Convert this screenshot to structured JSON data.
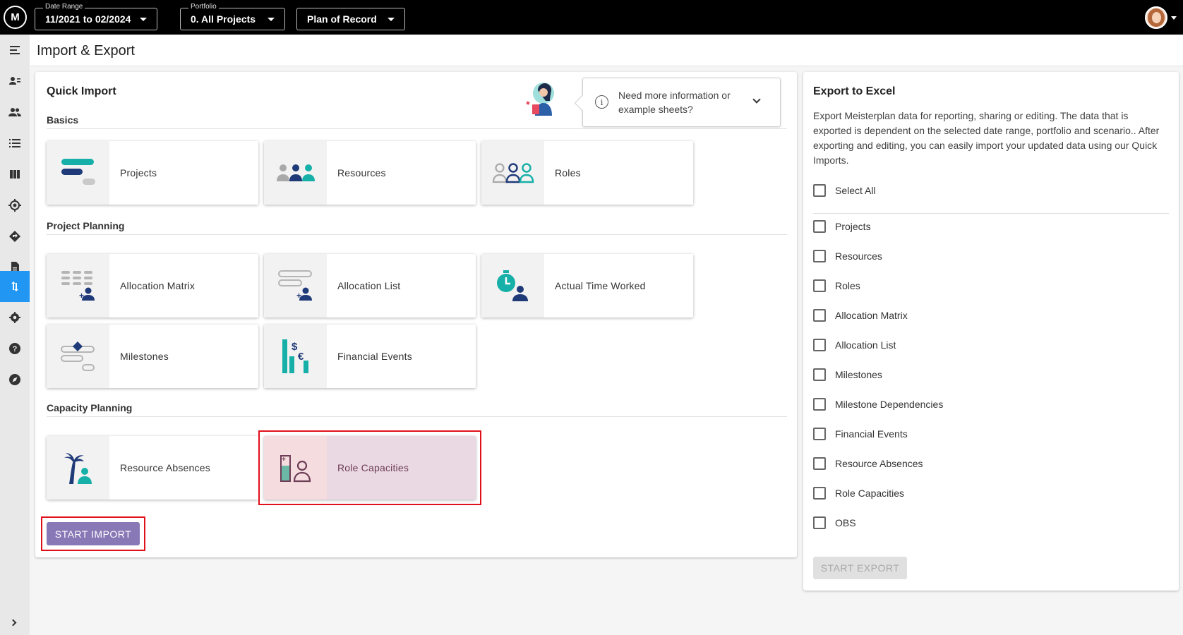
{
  "topbar": {
    "logo": "M",
    "date_range": {
      "label": "Date Range",
      "value": "11/2021 to 02/2024"
    },
    "portfolio": {
      "label": "Portfolio",
      "value": "0. All Projects"
    },
    "scenario": {
      "value": "Plan of Record"
    }
  },
  "sidenav": {
    "items": [
      {
        "icon": "menu-collapse-icon"
      },
      {
        "icon": "resource-list-icon"
      },
      {
        "icon": "people-icon"
      },
      {
        "icon": "list-icon"
      },
      {
        "icon": "columns-icon"
      },
      {
        "icon": "target-icon"
      },
      {
        "icon": "diamond-direction-icon"
      },
      {
        "icon": "document-icon"
      },
      {
        "icon": "import-export-icon",
        "active": true
      },
      {
        "icon": "gear-icon"
      },
      {
        "icon": "help-icon"
      },
      {
        "icon": "compass-icon"
      }
    ]
  },
  "page": {
    "title": "Import & Export"
  },
  "quick_import": {
    "title": "Quick Import",
    "help": {
      "text": "Need more information or example sheets?"
    },
    "sections": [
      {
        "label": "Basics",
        "tiles": [
          {
            "label": "Projects",
            "icon": "projects-icon"
          },
          {
            "label": "Resources",
            "icon": "resources-icon"
          },
          {
            "label": "Roles",
            "icon": "roles-icon"
          }
        ]
      },
      {
        "label": "Project Planning",
        "tiles": [
          {
            "label": "Allocation Matrix",
            "icon": "allocation-matrix-icon"
          },
          {
            "label": "Allocation List",
            "icon": "allocation-list-icon"
          },
          {
            "label": "Actual Time Worked",
            "icon": "actual-time-icon"
          },
          {
            "label": "Milestones",
            "icon": "milestones-icon"
          },
          {
            "label": "Financial Events",
            "icon": "financial-events-icon"
          }
        ]
      },
      {
        "label": "Capacity Planning",
        "tiles": [
          {
            "label": "Resource Absences",
            "icon": "resource-absences-icon"
          },
          {
            "label": "Role Capacities",
            "icon": "role-capacities-icon",
            "selected": true
          }
        ]
      }
    ],
    "start_button": "START IMPORT"
  },
  "export": {
    "title": "Export to Excel",
    "description": "Export Meisterplan data for reporting, sharing or editing. The data that is exported is dependent on the selected date range, portfolio and scenario.. After exporting and editing, you can easily import your updated data using our Quick Imports.",
    "select_all": "Select All",
    "options": [
      "Projects",
      "Resources",
      "Roles",
      "Allocation Matrix",
      "Allocation List",
      "Milestones",
      "Milestone Dependencies",
      "Financial Events",
      "Resource Absences",
      "Role Capacities",
      "OBS"
    ],
    "start_button": "START EXPORT"
  },
  "colors": {
    "teal": "#17b0a8",
    "navy": "#1e3a78",
    "accent_purple": "#8878b6",
    "highlight_red": "#e0101a",
    "nav_active": "#2196f3"
  }
}
